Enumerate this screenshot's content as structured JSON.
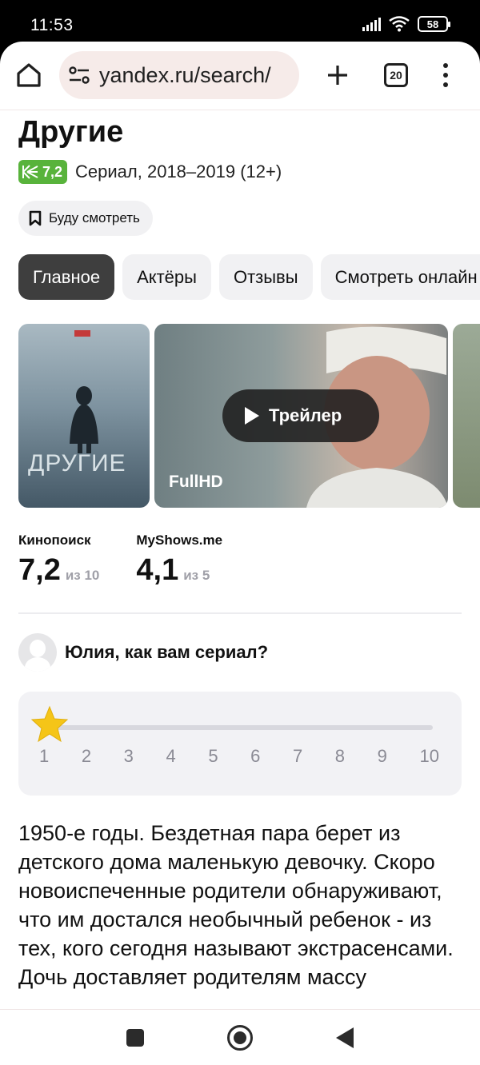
{
  "status_bar": {
    "time": "11:53",
    "battery": "58"
  },
  "browser": {
    "url": "yandex.ru/search/",
    "tab_count": "20"
  },
  "show": {
    "title": "Другие",
    "kp_rating": "7,2",
    "meta": "Сериал, 2018–2019 (12+)",
    "watch_later_label": "Буду смотреть"
  },
  "tabs": [
    {
      "label": "Главное",
      "active": true
    },
    {
      "label": "Актёры",
      "active": false
    },
    {
      "label": "Отзывы",
      "active": false
    },
    {
      "label": "Смотреть онлайн",
      "active": false
    }
  ],
  "gallery": {
    "poster_title": "ДРУГИЕ",
    "trailer_label": "Трейлер",
    "quality_label": "FullHD"
  },
  "ratings": [
    {
      "source": "Кинопоиск",
      "value": "7,2",
      "out_of": "из 10"
    },
    {
      "source": "MyShows.me",
      "value": "4,1",
      "out_of": "из 5"
    }
  ],
  "user_prompt": "Юлия, как вам сериал?",
  "rating_scale": {
    "selected": 1,
    "numbers": [
      "1",
      "2",
      "3",
      "4",
      "5",
      "6",
      "7",
      "8",
      "9",
      "10"
    ]
  },
  "description": "1950-е годы. Бездетная пара берет из детского дома маленькую девочку. Скоро новоиспеченные родители обнаруживают, что им достался необычный ребенок - из тех, кого сегодня называют экстрасенсами. Дочь доставляет родителям массу",
  "colors": {
    "kp_green": "#58b33b",
    "star": "#f5c518",
    "active_tab": "#3e3e3e"
  }
}
